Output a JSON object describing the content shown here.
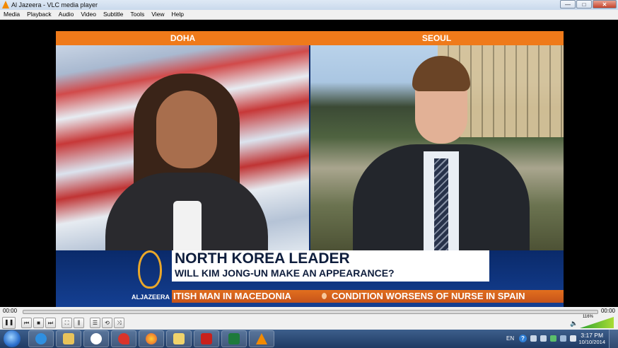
{
  "window": {
    "title": "Al Jazeera - VLC media player",
    "controls": [
      "—",
      "□",
      "✕"
    ]
  },
  "menu": [
    "Media",
    "Playback",
    "Audio",
    "Video",
    "Subtitle",
    "Tools",
    "View",
    "Help"
  ],
  "broadcast": {
    "left_city": "DOHA",
    "right_city": "SEOUL",
    "headline": "NORTH KOREA LEADER",
    "subheadline": "WILL KIM JONG-UN MAKE AN APPEARANCE?",
    "brand": "ALJAZEERA",
    "ticker": [
      "ITISH MAN IN MACEDONIA",
      "CONDITION WORSENS OF NURSE IN SPAIN"
    ]
  },
  "player": {
    "time_elapsed": "00:00",
    "time_total": "00:00",
    "volume_percent": "116%",
    "buttons": {
      "play_pause": "❚❚",
      "previous": "⏮",
      "stop": "■",
      "next": "⏭",
      "fullscreen": "⛶",
      "extended": "⫼",
      "playlist": "☰",
      "loop": "⟲",
      "random": "⤨"
    }
  },
  "taskbar": {
    "apps": [
      "internet-explorer",
      "file-explorer",
      "media-center",
      "pushpin",
      "firefox",
      "folder",
      "acrobat",
      "excel",
      "vlc"
    ],
    "language": "EN",
    "clock_time": "3:17 PM",
    "clock_date": "10/10/2014"
  },
  "colors": {
    "accent_orange": "#ef7a1a",
    "navy": "#0d2c6b",
    "taskbar": "#1f3a63"
  }
}
